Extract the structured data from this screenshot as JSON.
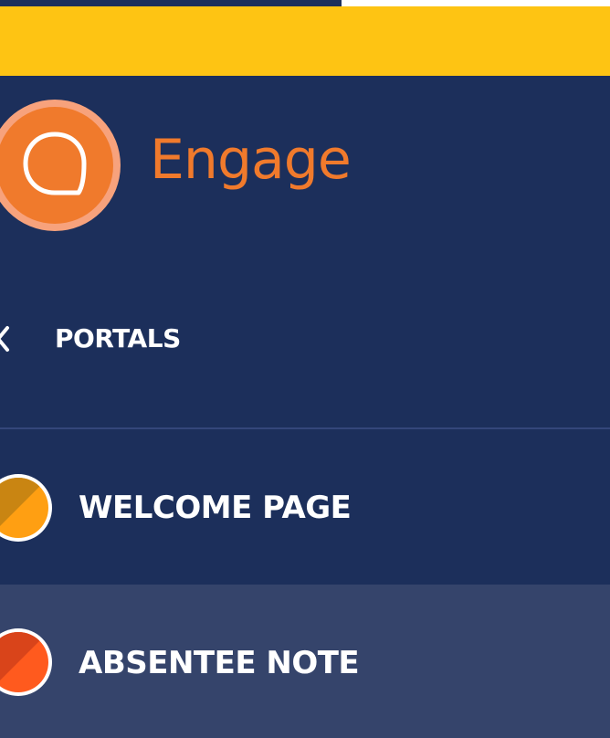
{
  "brand": {
    "name": "Engage",
    "color": "#f07a2c"
  },
  "header": {
    "accent_color": "#fec413"
  },
  "sidebar": {
    "background": "#1c2f5b",
    "back": {
      "icon": "chevron-left-icon",
      "label": "PORTALS"
    },
    "portals": [
      {
        "label": "WELCOME PAGE",
        "icon": "portal-color-dot-icon",
        "color_a": "#c98512",
        "color_b": "#ff9f12",
        "selected": false
      },
      {
        "label": "ABSENTEE NOTE",
        "icon": "portal-color-dot-icon",
        "color_a": "#d9441a",
        "color_b": "#ff5a1e",
        "selected": true
      }
    ]
  }
}
